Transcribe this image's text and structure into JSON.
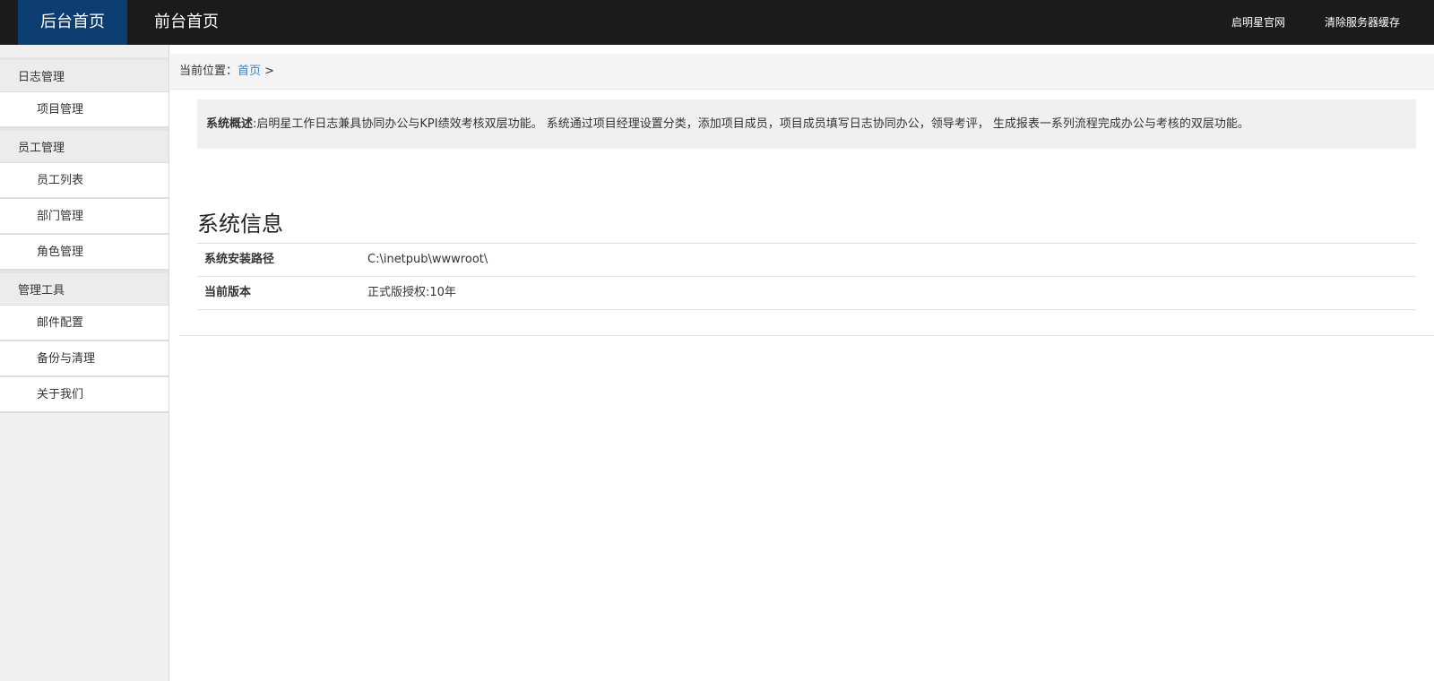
{
  "topbar": {
    "nav": [
      {
        "label": "后台首页",
        "active": true
      },
      {
        "label": "前台首页",
        "active": false
      }
    ],
    "links": [
      "启明星官网",
      "清除服务器缓存"
    ]
  },
  "sidebar": {
    "groups": [
      {
        "title": "日志管理",
        "items": [
          "项目管理"
        ]
      },
      {
        "title": "员工管理",
        "items": [
          "员工列表",
          "部门管理",
          "角色管理"
        ]
      },
      {
        "title": "管理工具",
        "items": [
          "邮件配置",
          "备份与清理",
          "关于我们"
        ]
      }
    ]
  },
  "breadcrumb": {
    "prefix": "当前位置：",
    "link": "首页",
    "separator": ">"
  },
  "intro": {
    "label": "系统概述",
    "text": ":启明星工作日志兼具协同办公与KPI绩效考核双层功能。 系统通过项目经理设置分类，添加项目成员，项目成员填写日志协同办公，领导考评， 生成报表一系列流程完成办公与考核的双层功能。"
  },
  "system_info": {
    "title": "系统信息",
    "rows": [
      {
        "key": "系统安装路径",
        "value": "C:\\inetpub\\wwwroot\\"
      },
      {
        "key": "当前版本",
        "value": "正式版授权:10年"
      }
    ]
  },
  "colors": {
    "topbar_bg": "#1b1b1b",
    "active_nav_bg": "#0c3e72",
    "link_blue": "#3f83c5"
  }
}
